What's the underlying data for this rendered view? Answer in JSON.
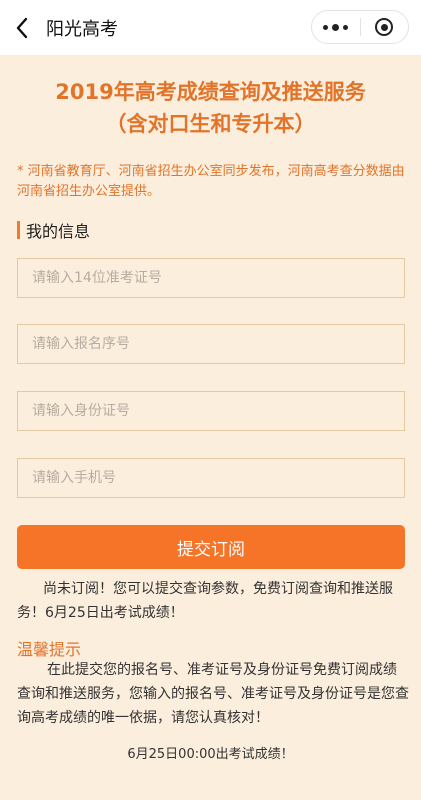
{
  "nav": {
    "back_icon": "chevron-left-icon",
    "title": "阳光高考",
    "more_icon": "more-dots-icon",
    "close_icon": "record-circle-icon"
  },
  "header": {
    "title_line1": "2019年高考成绩查询及推送服务",
    "title_line2": "（含对口生和专升本）"
  },
  "notice": "* 河南省教育厅、河南省招生办公室同步发布，河南高考查分数据由河南省招生办公室提供。",
  "section": {
    "title": "我的信息"
  },
  "form": {
    "exam_id_placeholder": "请输入14位准考证号",
    "reg_no_placeholder": "请输入报名序号",
    "id_card_placeholder": "请输入身份证号",
    "phone_placeholder": "请输入手机号",
    "submit_label": "提交订阅"
  },
  "status_text": "尚未订阅！您可以提交查询参数，免费订阅查询和推送服务！6月25日出考试成绩！",
  "tips": {
    "title": "温馨提示",
    "body": "在此提交您的报名号、准考证号及身份证号免费订阅成绩查询和推送服务，您输入的报名号、准考证号及身份证号是您查询高考成绩的唯一依据，请您认真核对！"
  },
  "footer": "6月25日00:00出考试成绩！",
  "colors": {
    "accent": "#e2742a",
    "button": "#f57427",
    "background": "#fbeedd"
  }
}
